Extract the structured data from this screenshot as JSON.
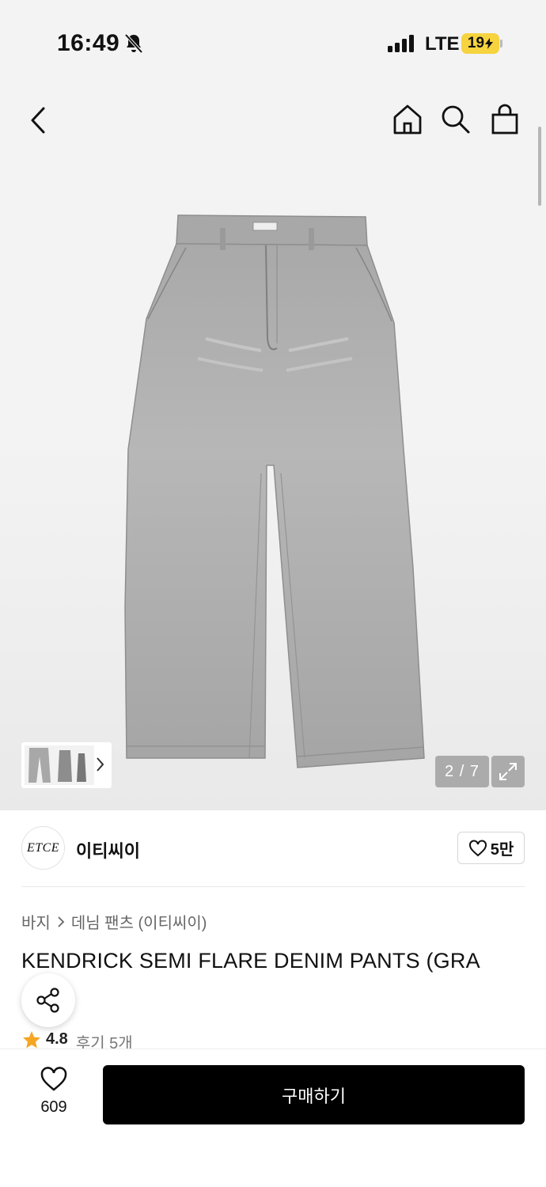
{
  "status_bar": {
    "time": "16:49",
    "network": "LTE",
    "battery": "19"
  },
  "nav": {
    "icons": [
      "back-icon",
      "home-icon",
      "search-icon",
      "shopping-bag-icon"
    ]
  },
  "gallery": {
    "counter": "2 / 7",
    "current": 2,
    "total": 7
  },
  "brand": {
    "logo_text": "ETCE",
    "name": "이티씨이",
    "likes": "5만"
  },
  "breadcrumb": {
    "category": "바지",
    "subcategory": "데님 팬츠 (이티씨이)"
  },
  "product": {
    "title": "KENDRICK SEMI FLARE DENIM PANTS (GRA",
    "rating": "4.8",
    "reviews": "후기 5개"
  },
  "bottom_bar": {
    "wish_count": "609",
    "buy_label": "구매하기"
  },
  "colors": {
    "accent_star": "#f5a623",
    "battery": "#f6d33f",
    "buy_button": "#000000"
  }
}
